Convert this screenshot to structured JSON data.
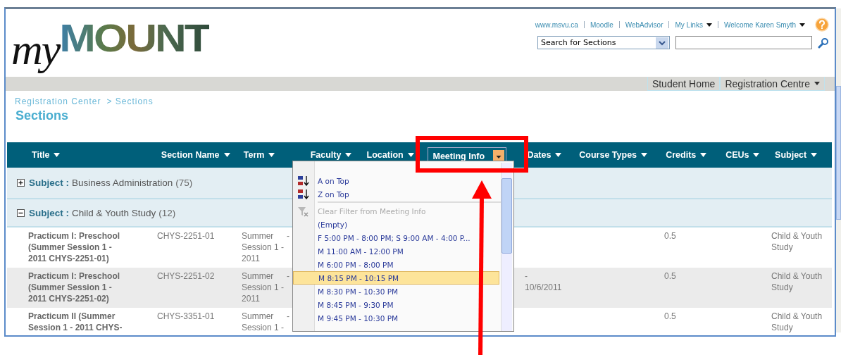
{
  "header": {
    "logo": {
      "script": "my",
      "word": "MOUNT"
    },
    "top_links": [
      {
        "label": "www.msvu.ca",
        "dropdown": false
      },
      {
        "label": "Moodle",
        "dropdown": false
      },
      {
        "label": "WebAdvisor",
        "dropdown": false
      },
      {
        "label": "My Links",
        "dropdown": true
      },
      {
        "label": "Welcome Karen Smyth",
        "dropdown": true
      }
    ],
    "search": {
      "scope": "Search for Sections"
    }
  },
  "nav_tabs": [
    {
      "label": "Student Home",
      "dropdown": false
    },
    {
      "label": "Registration Centre",
      "dropdown": true
    }
  ],
  "breadcrumb": [
    "Registration Center",
    "> Sections"
  ],
  "page_title": "Sections",
  "table": {
    "columns": [
      {
        "label": "Title",
        "active": false
      },
      {
        "label": "Section Name",
        "active": false
      },
      {
        "label": "Term",
        "active": false
      },
      {
        "label": "Faculty",
        "active": false
      },
      {
        "label": "Location",
        "active": false
      },
      {
        "label": "Meeting Info",
        "active": true
      },
      {
        "label": "Dates",
        "active": false
      },
      {
        "label": "Course Types",
        "active": false
      },
      {
        "label": "Credits",
        "active": false
      },
      {
        "label": "CEUs",
        "active": false
      },
      {
        "label": "Subject",
        "active": false
      }
    ],
    "groups": [
      {
        "label": "Subject :",
        "value": "Business Administration",
        "count": "(75)",
        "expanded": false
      },
      {
        "label": "Subject :",
        "value": "Child & Youth Study",
        "count": "(12)",
        "expanded": true,
        "rows": [
          {
            "title": "Practicum I: Preschool (Summer Session 1 - 2011 CHYS-2251-01)",
            "section": "CHYS-2251-01",
            "term": "Summer Session 1 - 2011",
            "faculty": "-",
            "credits": "0.5",
            "subject": "Child & Youth Study"
          },
          {
            "title": "Practicum I: Preschool (Summer Session 1 - 2011 CHYS-2251-02)",
            "section": "CHYS-2251-02",
            "term": "Summer Session 1 - 2011",
            "faculty": "-",
            "dates": "-\n10/6/2011",
            "credits": "0.5",
            "subject": "Child & Youth Study"
          },
          {
            "title": "Practicum II (Summer Session 1 - 2011 CHYS-",
            "section": "CHYS-3351-01",
            "term": "Summer Session 1 -",
            "faculty": "-",
            "credits": "0.5",
            "subject": "Child & Youth Study"
          }
        ]
      }
    ]
  },
  "filter_menu": {
    "items": [
      {
        "kind": "sort-asc",
        "label": "A on Top",
        "highlighted": false,
        "disabled": false
      },
      {
        "kind": "sort-desc",
        "label": "Z on Top",
        "highlighted": false,
        "disabled": false
      },
      {
        "kind": "clear",
        "label": "Clear Filter from Meeting Info",
        "highlighted": false,
        "disabled": true
      },
      {
        "kind": "value",
        "label": "(Empty)",
        "highlighted": false,
        "disabled": false
      },
      {
        "kind": "value",
        "label": "F 5:00 PM - 8:00 PM; S 9:00 AM - 4:00 P...",
        "highlighted": false,
        "disabled": false
      },
      {
        "kind": "value",
        "label": "M 11:00 AM - 12:00 PM",
        "highlighted": false,
        "disabled": false
      },
      {
        "kind": "value",
        "label": "M 6:00 PM - 8:00 PM",
        "highlighted": false,
        "disabled": false
      },
      {
        "kind": "value",
        "label": "M 8:15 PM - 10:15 PM",
        "highlighted": true,
        "disabled": false
      },
      {
        "kind": "value",
        "label": "M 8:30 PM - 10:30 PM",
        "highlighted": false,
        "disabled": false
      },
      {
        "kind": "value",
        "label": "M 8:45 PM - 9:30 PM",
        "highlighted": false,
        "disabled": false
      },
      {
        "kind": "value",
        "label": "M 9:45 PM - 10:30 PM",
        "highlighted": false,
        "disabled": false
      }
    ]
  }
}
